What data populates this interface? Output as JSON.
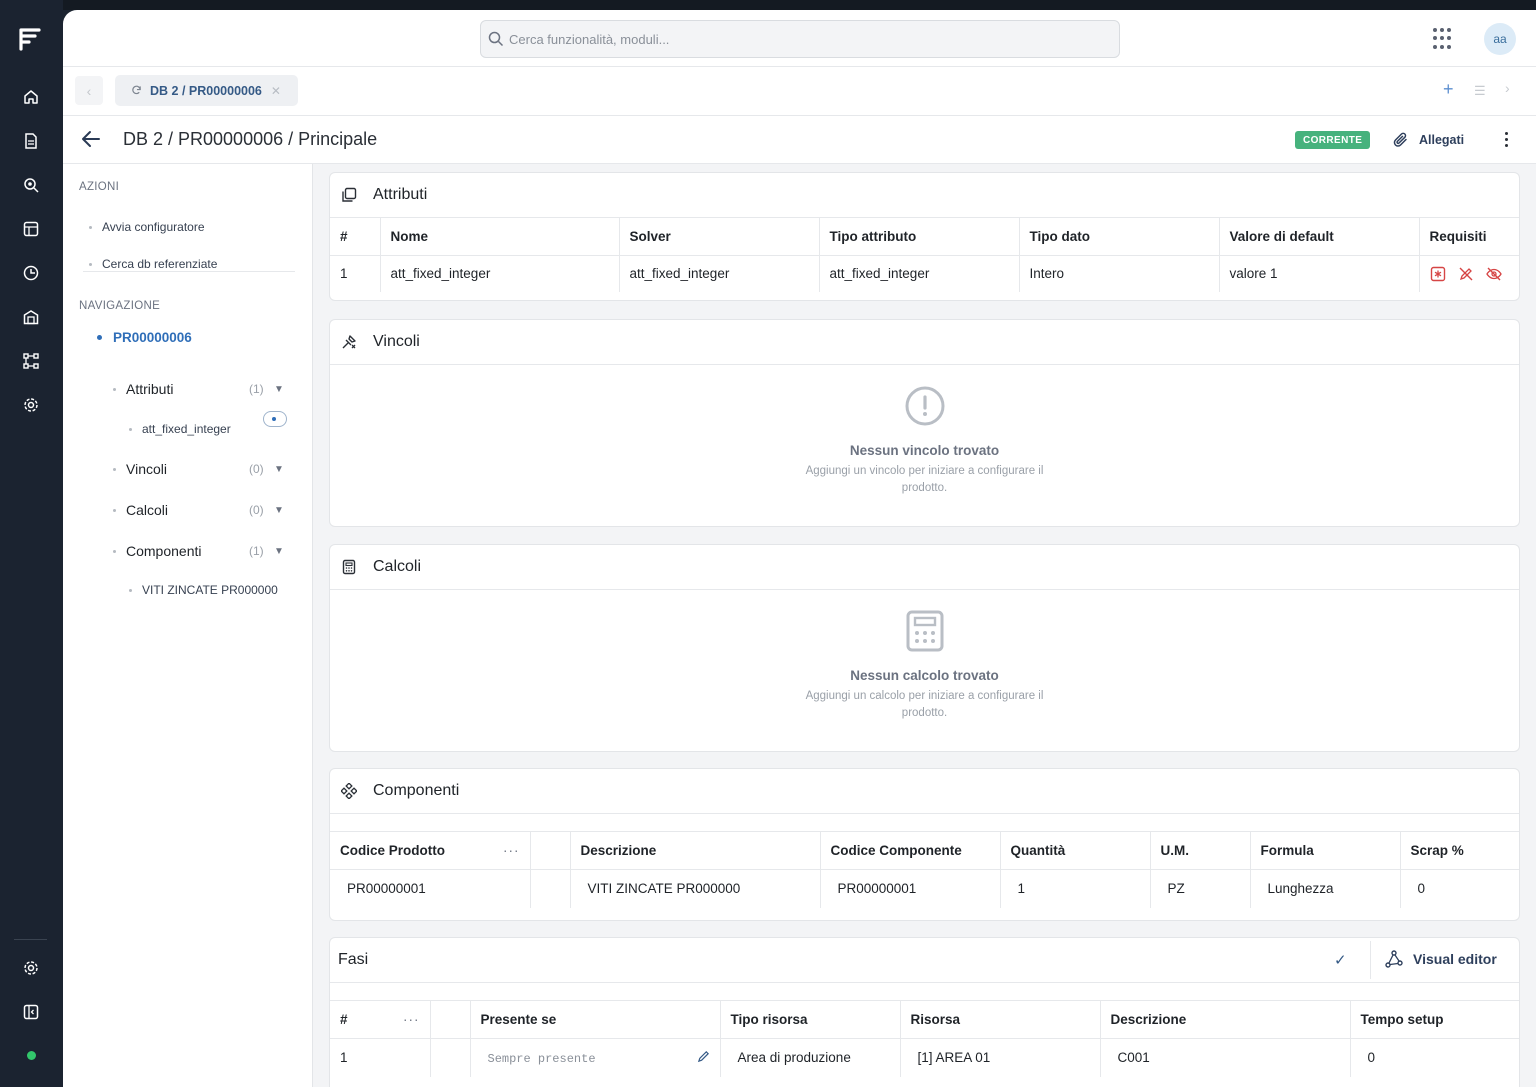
{
  "search": {
    "placeholder": "Cerca funzionalità, moduli..."
  },
  "user": {
    "initials": "aa"
  },
  "tabs": [
    {
      "label": "DB 2 / PR00000006"
    }
  ],
  "page": {
    "title": "DB 2 / PR00000006 / Principale",
    "status_badge": "CORRENTE",
    "attachments_label": "Allegati"
  },
  "sidebar": {
    "actions_title": "AZIONI",
    "actions": [
      "Avvia configuratore",
      "Cerca db referenziate"
    ],
    "nav_title": "NAVIGAZIONE",
    "root": "PR00000006",
    "groups": [
      {
        "label": "Attributi",
        "count": "(1)",
        "children": [
          "att_fixed_integer"
        ]
      },
      {
        "label": "Vincoli",
        "count": "(0)",
        "children": []
      },
      {
        "label": "Calcoli",
        "count": "(0)",
        "children": []
      },
      {
        "label": "Componenti",
        "count": "(1)",
        "children": [
          "VITI ZINCATE PR000000"
        ]
      }
    ]
  },
  "attributi": {
    "title": "Attributi",
    "columns": [
      "#",
      "Nome",
      "Solver",
      "Tipo attributo",
      "Tipo dato",
      "Valore di default",
      "Requisiti"
    ],
    "rows": [
      {
        "n": "1",
        "nome": "att_fixed_integer",
        "solver": "att_fixed_integer",
        "tipo_attributo": "att_fixed_integer",
        "tipo_dato": "Intero",
        "default": "valore 1"
      }
    ],
    "requirement_icons": [
      "required-icon",
      "no-edit-icon",
      "hidden-icon"
    ],
    "accent_color": "#d64545"
  },
  "vincoli": {
    "title": "Vincoli",
    "empty_title": "Nessun vincolo trovato",
    "empty_sub": "Aggiungi un vincolo per iniziare a configurare il prodotto."
  },
  "calcoli": {
    "title": "Calcoli",
    "empty_title": "Nessun calcolo trovato",
    "empty_sub": "Aggiungi un calcolo per iniziare a configurare il prodotto."
  },
  "componenti": {
    "title": "Componenti",
    "columns": [
      "Codice Prodotto",
      "",
      "Descrizione",
      "Codice Componente",
      "Quantità",
      "U.M.",
      "Formula",
      "Scrap %"
    ],
    "rows": [
      {
        "codice_prodotto": "PR00000001",
        "descrizione": "VITI ZINCATE PR000000",
        "codice_componente": "PR00000001",
        "quantita": "1",
        "um": "PZ",
        "formula": "Lunghezza",
        "scrap": "0"
      }
    ]
  },
  "fasi": {
    "title": "Fasi",
    "visual_editor": "Visual editor",
    "columns": [
      "#",
      "",
      "Presente se",
      "Tipo risorsa",
      "Risorsa",
      "Descrizione",
      "Tempo setup"
    ],
    "rows": [
      {
        "n": "1",
        "presente_se": "Sempre presente",
        "tipo_risorsa": "Area di produzione",
        "risorsa": "[1] AREA 01",
        "descrizione": "C001",
        "tempo_setup": "0"
      }
    ]
  }
}
